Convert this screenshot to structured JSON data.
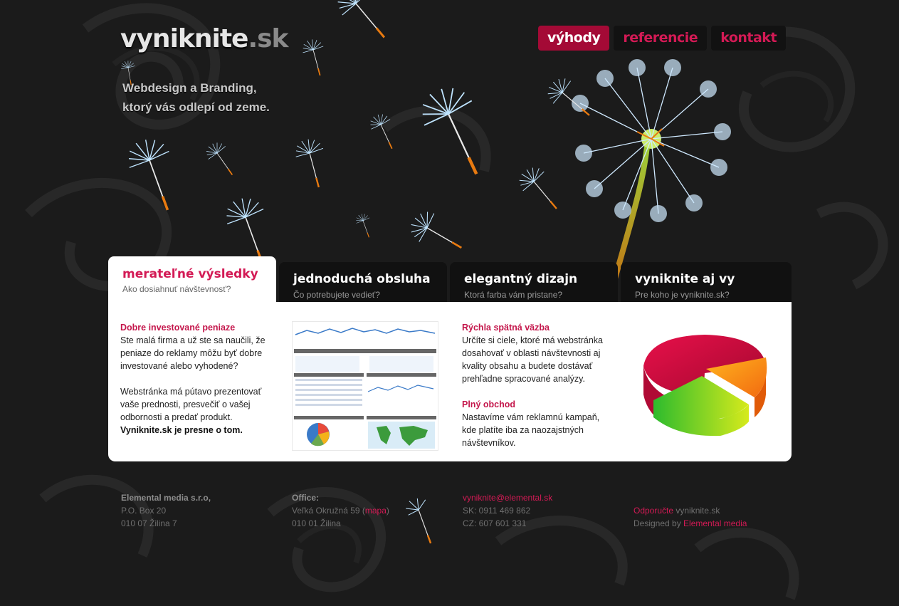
{
  "header": {
    "logo_main": "vyniknite",
    "logo_tld": ".sk",
    "tagline_line1": "Webdesign a Branding,",
    "tagline_line2": "ktorý vás odlepí od zeme."
  },
  "topnav": {
    "items": [
      {
        "label": "výhody",
        "active": true
      },
      {
        "label": "referencie",
        "active": false
      },
      {
        "label": "kontakt",
        "active": false
      }
    ]
  },
  "tabs": [
    {
      "title": "merateľné výsledky",
      "subtitle": "Ako dosiahnuť návštevnosť?",
      "active": true
    },
    {
      "title": "jednoduchá obsluha",
      "subtitle": "Čo potrebujete vedieť?",
      "active": false
    },
    {
      "title": "elegantný dizajn",
      "subtitle": "Ktorá farba vám pristane?",
      "active": false
    },
    {
      "title": "vyniknite aj vy",
      "subtitle": "Pre koho je vyniknite.sk?",
      "active": false
    }
  ],
  "content": {
    "col1": {
      "heading": "Dobre investované peniaze",
      "p1": "Ste malá firma a už ste sa naučili, že peniaze do reklamy môžu byť dobre investované alebo vyhodené?",
      "p2": "Webstránka má pútavo prezentovať vaše prednosti, presvečiť o vašej odbornosti a predať produkt.",
      "p3": "Vyniknite.sk je presne o tom."
    },
    "col3": {
      "heading1": "Rýchla spätná väzba",
      "p1": "Určíte si ciele, ktoré má webstránka dosahovať v oblasti návštevnosti aj kvality obsahu a budete dostávať prehľadne spracované analýzy.",
      "heading2": "Plný obchod",
      "p2": "Nastavíme vám reklamnú kampaň, kde platíte iba za naozajstných návštevníkov."
    }
  },
  "footer": {
    "company": {
      "name": "Elemental media s.r.o,",
      "line1": "P.O. Box 20",
      "line2": "010 07 Žilina 7"
    },
    "office": {
      "label": "Office:",
      "street_prefix": "Veľká Okružná 59 (",
      "map_link": "mapa",
      "street_suffix": ")",
      "city": "010 01 Žilina"
    },
    "contact": {
      "email": "vyniknite@elemental.sk",
      "sk": "SK: 0911 469 862",
      "cz": "CZ: 607 601 331"
    },
    "credits": {
      "recommend_link": "Odporučte",
      "recommend_text": " vyniknite.sk",
      "designed_prefix": "Designed by ",
      "designed_link": "Elemental media"
    }
  },
  "colors": {
    "accent": "#d31a55",
    "nav_active_bg": "#a40a36",
    "background": "#1b1b1b"
  }
}
